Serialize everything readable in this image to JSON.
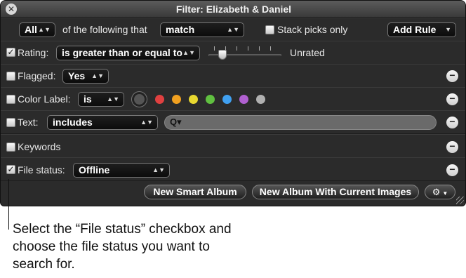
{
  "window": {
    "title": "Filter: Elizabeth & Daniel"
  },
  "header": {
    "all_value": "All",
    "of_following_label": "of the following that",
    "match_value": "match",
    "stack_picks_label": "Stack picks only",
    "add_rule_label": "Add Rule"
  },
  "rules": {
    "rating": {
      "label": "Rating:",
      "operator": "is greater than or equal to",
      "status": "Unrated",
      "checked": "✓"
    },
    "flagged": {
      "label": "Flagged:",
      "value": "Yes"
    },
    "color_label": {
      "label": "Color Label:",
      "operator": "is",
      "colors": [
        "#e04040",
        "#f0a020",
        "#e8d830",
        "#60c040",
        "#40a0f0",
        "#b060d0",
        "#b0b0b0"
      ]
    },
    "text": {
      "label": "Text:",
      "operator": "includes",
      "search_glyph": "Q▾"
    },
    "keywords": {
      "label": "Keywords"
    },
    "file_status": {
      "label": "File status:",
      "value": "Offline",
      "checked": "✓"
    }
  },
  "footer": {
    "new_smart_album_label": "New Smart Album",
    "new_album_current_label": "New Album With Current Images"
  },
  "caption": {
    "text": "Select the “File status” checkbox and choose the file status you want to search for."
  }
}
